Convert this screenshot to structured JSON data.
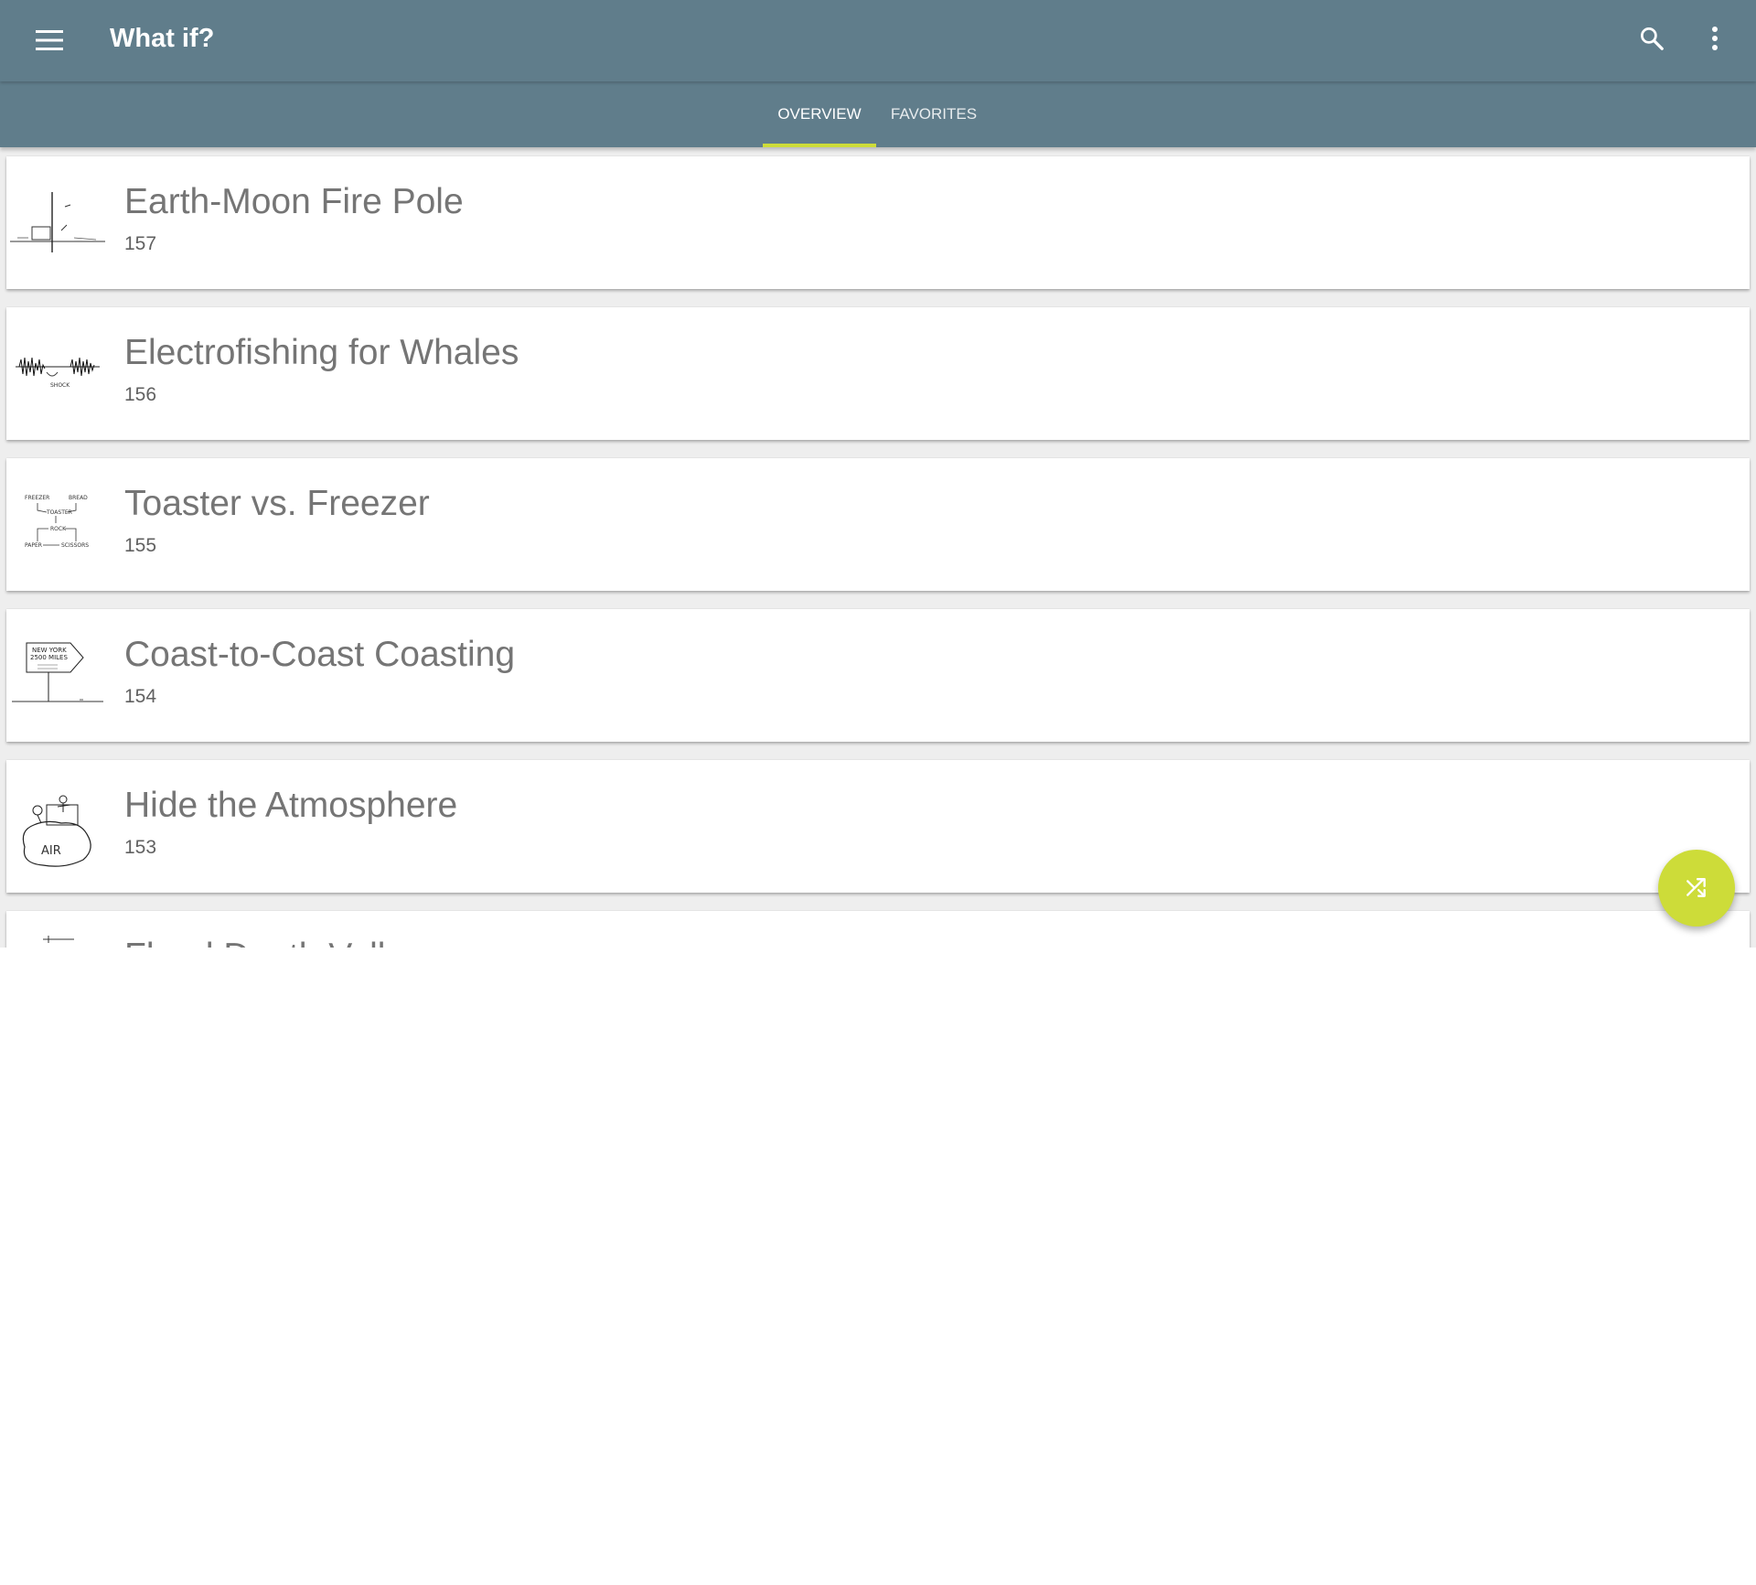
{
  "app": {
    "title": "What if?"
  },
  "toolbar": {
    "menu_icon": "hamburger-menu-icon",
    "search_icon": "search-icon",
    "more_icon": "more-vert-icon"
  },
  "tabs": [
    {
      "label": "OVERVIEW",
      "selected": true
    },
    {
      "label": "FAVORITES",
      "selected": false
    }
  ],
  "articles": [
    {
      "title": "Earth-Moon Fire Pole",
      "number": "157"
    },
    {
      "title": "Electrofishing for Whales",
      "number": "156"
    },
    {
      "title": "Toaster vs. Freezer",
      "number": "155"
    },
    {
      "title": "Coast-to-Coast Coasting",
      "number": "154"
    },
    {
      "title": "Hide the Atmosphere",
      "number": "153"
    },
    {
      "title": "Flood Death Valley",
      "number": ""
    }
  ],
  "thumb_text": {
    "toaster": {
      "freezer": "FREEZER",
      "bread": "BREAD",
      "toaster": "TOASTER",
      "rock": "ROCK",
      "paper": "PAPER",
      "scissors": "SCISSORS"
    },
    "coast": {
      "line1": "NEW YORK",
      "line2": "2500 MILES"
    },
    "whales": {
      "label": "SHOCK"
    },
    "atmosphere": {
      "label": "AIR"
    }
  },
  "fab": {
    "icon": "shuffle-icon",
    "color": "#cddc39"
  },
  "colors": {
    "primary": "#607d8b",
    "accent": "#cddc39",
    "background": "#eeeeee"
  }
}
